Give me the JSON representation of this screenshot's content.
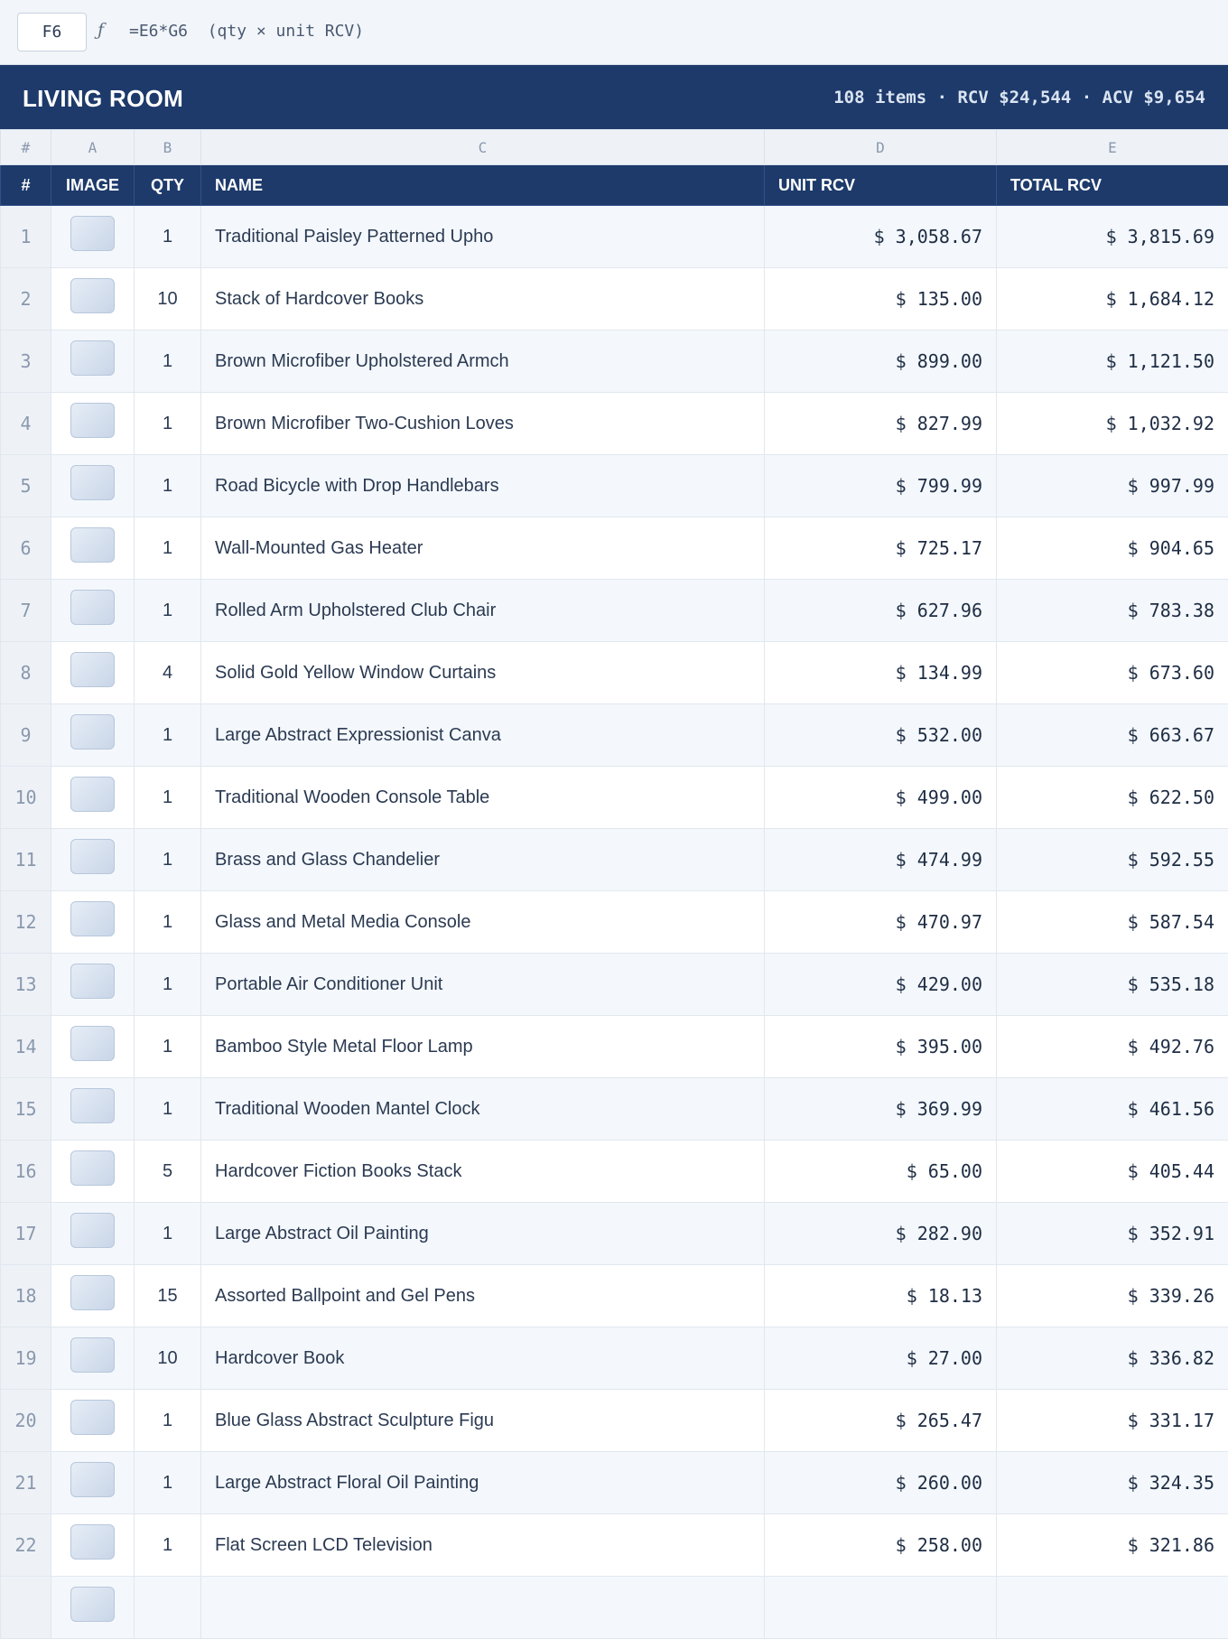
{
  "formula_bar": {
    "cell_ref": "F6",
    "fx_symbol": "ƒ",
    "formula": "=E6*G6  (qty × unit RCV)"
  },
  "section": {
    "title": "LIVING ROOM",
    "summary": "108 items · RCV $24,544 · ACV $9,654"
  },
  "columns": {
    "letters": [
      "#",
      "A",
      "B",
      "C",
      "D",
      "E"
    ],
    "headers": [
      "#",
      "IMAGE",
      "QTY",
      "NAME",
      "UNIT RCV",
      "TOTAL RCV"
    ]
  },
  "rows": [
    {
      "num": "1",
      "qty": "1",
      "name": "Traditional Paisley Patterned Upho",
      "unit": "$ 3,058.67",
      "total": "$ 3,815.69"
    },
    {
      "num": "2",
      "qty": "10",
      "name": "Stack of Hardcover Books",
      "unit": "$ 135.00",
      "total": "$ 1,684.12"
    },
    {
      "num": "3",
      "qty": "1",
      "name": "Brown Microfiber Upholstered Armch",
      "unit": "$ 899.00",
      "total": "$ 1,121.50"
    },
    {
      "num": "4",
      "qty": "1",
      "name": "Brown Microfiber Two-Cushion Loves",
      "unit": "$ 827.99",
      "total": "$ 1,032.92"
    },
    {
      "num": "5",
      "qty": "1",
      "name": "Road Bicycle with Drop Handlebars",
      "unit": "$ 799.99",
      "total": "$ 997.99"
    },
    {
      "num": "6",
      "qty": "1",
      "name": "Wall-Mounted Gas Heater",
      "unit": "$ 725.17",
      "total": "$ 904.65"
    },
    {
      "num": "7",
      "qty": "1",
      "name": "Rolled Arm Upholstered Club Chair",
      "unit": "$ 627.96",
      "total": "$ 783.38"
    },
    {
      "num": "8",
      "qty": "4",
      "name": "Solid Gold Yellow Window Curtains",
      "unit": "$ 134.99",
      "total": "$ 673.60"
    },
    {
      "num": "9",
      "qty": "1",
      "name": "Large Abstract Expressionist Canva",
      "unit": "$ 532.00",
      "total": "$ 663.67"
    },
    {
      "num": "10",
      "qty": "1",
      "name": "Traditional Wooden Console Table",
      "unit": "$ 499.00",
      "total": "$ 622.50"
    },
    {
      "num": "11",
      "qty": "1",
      "name": "Brass and Glass Chandelier",
      "unit": "$ 474.99",
      "total": "$ 592.55"
    },
    {
      "num": "12",
      "qty": "1",
      "name": "Glass and Metal Media Console",
      "unit": "$ 470.97",
      "total": "$ 587.54"
    },
    {
      "num": "13",
      "qty": "1",
      "name": "Portable Air Conditioner Unit",
      "unit": "$ 429.00",
      "total": "$ 535.18"
    },
    {
      "num": "14",
      "qty": "1",
      "name": "Bamboo Style Metal Floor Lamp",
      "unit": "$ 395.00",
      "total": "$ 492.76"
    },
    {
      "num": "15",
      "qty": "1",
      "name": "Traditional Wooden Mantel Clock",
      "unit": "$ 369.99",
      "total": "$ 461.56"
    },
    {
      "num": "16",
      "qty": "5",
      "name": "Hardcover Fiction Books Stack",
      "unit": "$ 65.00",
      "total": "$ 405.44"
    },
    {
      "num": "17",
      "qty": "1",
      "name": "Large Abstract Oil Painting",
      "unit": "$ 282.90",
      "total": "$ 352.91"
    },
    {
      "num": "18",
      "qty": "15",
      "name": "Assorted Ballpoint and Gel Pens",
      "unit": "$ 18.13",
      "total": "$ 339.26"
    },
    {
      "num": "19",
      "qty": "10",
      "name": "Hardcover Book",
      "unit": "$ 27.00",
      "total": "$ 336.82"
    },
    {
      "num": "20",
      "qty": "1",
      "name": "Blue Glass Abstract Sculpture Figu",
      "unit": "$ 265.47",
      "total": "$ 331.17"
    },
    {
      "num": "21",
      "qty": "1",
      "name": "Large Abstract Floral Oil Painting",
      "unit": "$ 260.00",
      "total": "$ 324.35"
    },
    {
      "num": "22",
      "qty": "1",
      "name": "Flat Screen LCD Television",
      "unit": "$ 258.00",
      "total": "$ 321.86"
    },
    {
      "num": "",
      "qty": "",
      "name": "",
      "unit": "",
      "total": ""
    }
  ],
  "colors": {
    "header_navy": "#1d3a6b",
    "row_stripe": "#f4f8fc",
    "gutter": "#eef2f7"
  },
  "icons": {
    "formula": "function-icon",
    "thumbnail": "image-thumbnail-icon"
  }
}
